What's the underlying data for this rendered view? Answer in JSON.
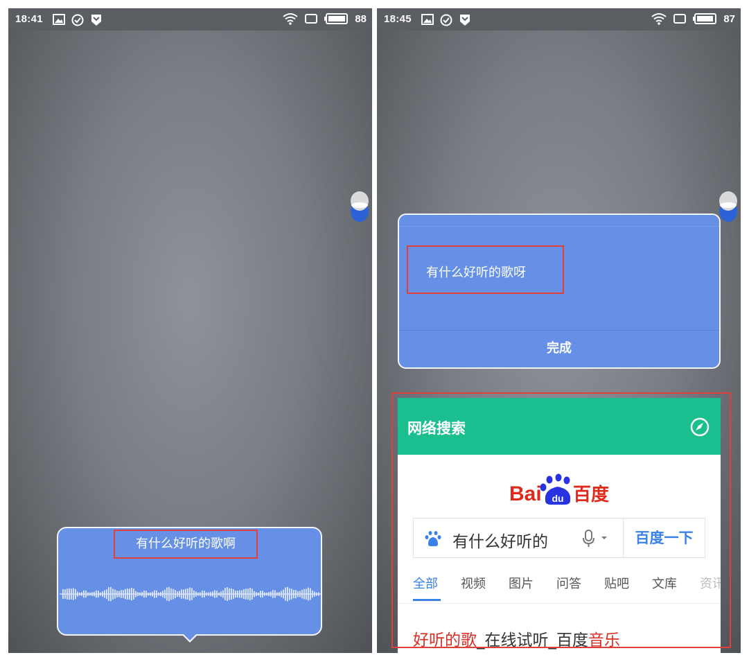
{
  "left_screen": {
    "status_bar": {
      "time": "18:41",
      "battery": "88"
    },
    "voice_panel": {
      "recognized_text": "有什么好听的歌啊"
    }
  },
  "right_screen": {
    "status_bar": {
      "time": "18:45",
      "battery": "87"
    },
    "result_panel": {
      "query_text": "有什么好听的歌呀",
      "done_label": "完成"
    },
    "web_card": {
      "title": "网络搜索",
      "baidu_logo": {
        "part1": "Bai",
        "part2": "百度",
        "paw_text": "du"
      },
      "search_input_value": "有什么好听的",
      "search_button": "百度一下",
      "tabs": [
        "全部",
        "视频",
        "图片",
        "问答",
        "贴吧",
        "文库",
        "资讯"
      ],
      "active_tab": "全部",
      "result_link": {
        "hl1": "好听的歌",
        "mid": "_在线试听_百度",
        "hl2": "音乐"
      }
    }
  },
  "colors": {
    "panel_blue": "#6690e6",
    "highlight_red": "#e0403a",
    "card_green": "#1bbf8f",
    "link_blue": "#3a82e8",
    "baidu_red": "#de2a1a",
    "baidu_blue": "#2932e1"
  },
  "icons": [
    "image-icon",
    "check-circle-icon",
    "shield-icon",
    "wifi-icon",
    "screen-icon",
    "battery-icon",
    "floating-ball-icon",
    "compass-icon",
    "baidu-paw-icon",
    "microphone-icon",
    "chevron-down-icon"
  ]
}
